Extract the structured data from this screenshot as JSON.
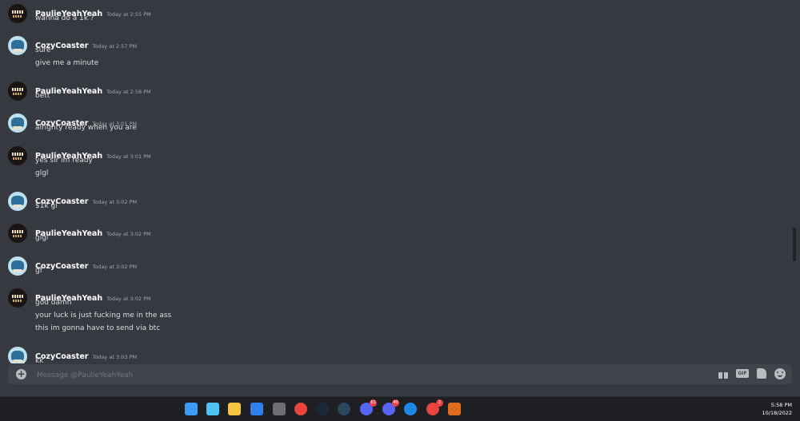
{
  "chat": {
    "messages": [
      {
        "author": "PaulieYeahYeah",
        "avatar": "paulie-avatar",
        "time": "Today at 2:55 PM",
        "lines": [
          "wanna do a 1k ?"
        ]
      },
      {
        "author": "CozyCoaster",
        "avatar": "cozy-avatar",
        "time": "Today at 2:57 PM",
        "lines": [
          "sure",
          "give me a minute"
        ]
      },
      {
        "author": "PaulieYeahYeah",
        "avatar": "paulie-avatar",
        "time": "Today at 2:58 PM",
        "lines": [
          "bett"
        ]
      },
      {
        "author": "CozyCoaster",
        "avatar": "cozy-avatar",
        "time": "Today at 3:01 PM",
        "lines": [
          "alrighty ready when you are"
        ]
      },
      {
        "author": "PaulieYeahYeah",
        "avatar": "paulie-avatar",
        "time": "Today at 3:01 PM",
        "lines": [
          "yes sir im ready",
          "glgl"
        ]
      },
      {
        "author": "CozyCoaster",
        "avatar": "cozy-avatar",
        "time": "Today at 3:02 PM",
        "lines": [
          "$1k gl"
        ]
      },
      {
        "author": "PaulieYeahYeah",
        "avatar": "paulie-avatar",
        "time": "Today at 3:02 PM",
        "lines": [
          "glgl"
        ]
      },
      {
        "author": "CozyCoaster",
        "avatar": "cozy-avatar",
        "time": "Today at 3:02 PM",
        "lines": [
          "gf"
        ]
      },
      {
        "author": "PaulieYeahYeah",
        "avatar": "paulie-avatar",
        "time": "Today at 3:02 PM",
        "lines": [
          "god damn",
          "your luck is just fucking me in the ass",
          "this im gonna have to send via btc"
        ]
      },
      {
        "author": "CozyCoaster",
        "avatar": "cozy-avatar",
        "time": "Today at 3:03 PM",
        "lines": [
          "kk"
        ]
      }
    ]
  },
  "composer": {
    "placeholder": "Message @PaulieYeahYeah",
    "add_icon": "plus-circle-icon",
    "gift_icon": "gift-icon",
    "gif_label": "GIF",
    "sticker_icon": "sticker-icon",
    "emoji_icon": "emoji-icon"
  },
  "taskbar": {
    "icons": [
      {
        "name": "windows-start-icon",
        "color": "#3c9df5"
      },
      {
        "name": "search-icon",
        "color": "#4fc3f7"
      },
      {
        "name": "file-explorer-icon",
        "color": "#f6c343"
      },
      {
        "name": "app-icon",
        "color": "#2f80ed"
      },
      {
        "name": "calculator-icon",
        "color": "#6d6f74"
      },
      {
        "name": "chrome-icon",
        "color": "#e8453c"
      },
      {
        "name": "steam-icon",
        "color": "#1b2838"
      },
      {
        "name": "steam-icon",
        "color": "#2a475e"
      },
      {
        "name": "discord-icon",
        "color": "#5865f2",
        "badge": "61"
      },
      {
        "name": "discord-icon",
        "color": "#5865f2",
        "badge": "40"
      },
      {
        "name": "media-player-icon",
        "color": "#1e88e5"
      },
      {
        "name": "chrome-icon",
        "color": "#e8453c",
        "badge": "2"
      },
      {
        "name": "app-icon",
        "color": "#e06d1f"
      }
    ],
    "time": "5:58 PM",
    "date": "10/18/2022"
  }
}
